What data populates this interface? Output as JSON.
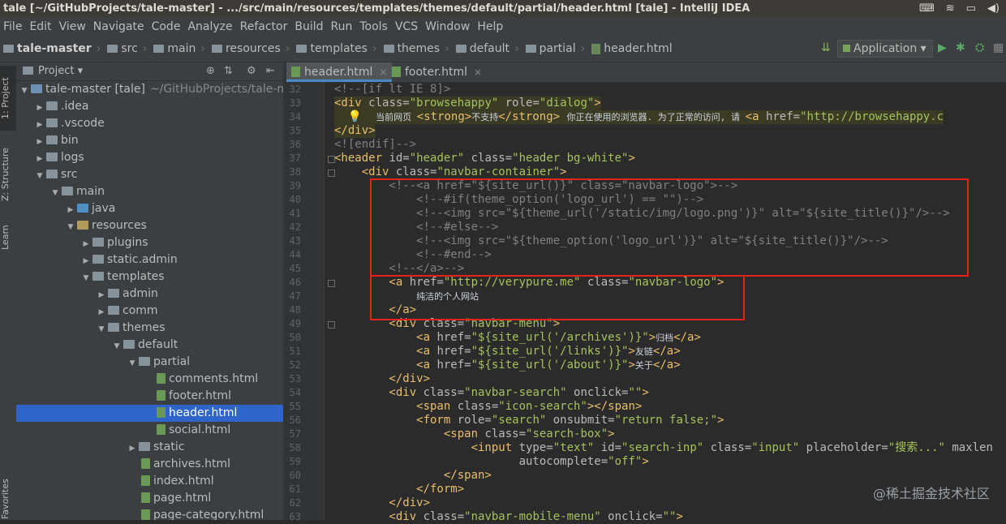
{
  "window": {
    "title": "tale [~/GitHubProjects/tale-master] - .../src/main/resources/templates/themes/default/partial/header.html [tale] - IntelliJ IDEA"
  },
  "tray": {
    "input_label": "⌨",
    "wifi": "≋",
    "battery": "▭",
    "volume": "◀)"
  },
  "menu": [
    "File",
    "Edit",
    "View",
    "Navigate",
    "Code",
    "Analyze",
    "Refactor",
    "Build",
    "Run",
    "Tools",
    "VCS",
    "Window",
    "Help"
  ],
  "breadcrumbs": [
    "tale-master",
    "src",
    "main",
    "resources",
    "templates",
    "themes",
    "default",
    "partial",
    "header.html"
  ],
  "toolbar": {
    "run_config": "Application ▾"
  },
  "left_strip": {
    "project": "1: Project",
    "structure": "Z: Structure",
    "learn": "Learn",
    "favorites": "Favorites"
  },
  "project_panel": {
    "title": "Project ▾"
  },
  "tree": [
    {
      "label": "tale-master [tale]",
      "hint": "~/GitHubProjects/tale-ma",
      "depth": 0,
      "arrow": "▼",
      "icon": "module"
    },
    {
      "label": ".idea",
      "depth": 1,
      "arrow": "▶",
      "icon": "folder"
    },
    {
      "label": ".vscode",
      "depth": 1,
      "arrow": "▶",
      "icon": "folder"
    },
    {
      "label": "bin",
      "depth": 1,
      "arrow": "▶",
      "icon": "folder"
    },
    {
      "label": "logs",
      "depth": 1,
      "arrow": "▶",
      "icon": "folder"
    },
    {
      "label": "src",
      "depth": 1,
      "arrow": "▼",
      "icon": "folder"
    },
    {
      "label": "main",
      "depth": 2,
      "arrow": "▼",
      "icon": "folder"
    },
    {
      "label": "java",
      "depth": 3,
      "arrow": "▶",
      "icon": "src"
    },
    {
      "label": "resources",
      "depth": 3,
      "arrow": "▼",
      "icon": "res"
    },
    {
      "label": "plugins",
      "depth": 4,
      "arrow": "▶",
      "icon": "folder"
    },
    {
      "label": "static.admin",
      "depth": 4,
      "arrow": "▶",
      "icon": "folder"
    },
    {
      "label": "templates",
      "depth": 4,
      "arrow": "▼",
      "icon": "folder"
    },
    {
      "label": "admin",
      "depth": 5,
      "arrow": "▶",
      "icon": "folder"
    },
    {
      "label": "comm",
      "depth": 5,
      "arrow": "▶",
      "icon": "folder"
    },
    {
      "label": "themes",
      "depth": 5,
      "arrow": "▼",
      "icon": "folder"
    },
    {
      "label": "default",
      "depth": 6,
      "arrow": "▼",
      "icon": "folder"
    },
    {
      "label": "partial",
      "depth": 7,
      "arrow": "▼",
      "icon": "folder"
    },
    {
      "label": "comments.html",
      "depth": 8,
      "arrow": "",
      "icon": "html"
    },
    {
      "label": "footer.html",
      "depth": 8,
      "arrow": "",
      "icon": "html"
    },
    {
      "label": "header.html",
      "depth": 8,
      "arrow": "",
      "icon": "html",
      "selected": true
    },
    {
      "label": "social.html",
      "depth": 8,
      "arrow": "",
      "icon": "html"
    },
    {
      "label": "static",
      "depth": 7,
      "arrow": "▶",
      "icon": "folder"
    },
    {
      "label": "archives.html",
      "depth": 7,
      "arrow": "",
      "icon": "html"
    },
    {
      "label": "index.html",
      "depth": 7,
      "arrow": "",
      "icon": "html"
    },
    {
      "label": "page.html",
      "depth": 7,
      "arrow": "",
      "icon": "html"
    },
    {
      "label": "page-category.html",
      "depth": 7,
      "arrow": "",
      "icon": "html"
    }
  ],
  "tabs": [
    {
      "label": "header.html",
      "active": true
    },
    {
      "label": "footer.html",
      "active": false
    }
  ],
  "code": {
    "first_line": 32,
    "lines": [
      [
        [
          "c",
          "<!--[if lt IE 8]>"
        ]
      ],
      [
        [
          "t",
          "<div "
        ],
        [
          "a",
          "class="
        ],
        [
          "v",
          "\"browsehappy\" "
        ],
        [
          "a",
          "role="
        ],
        [
          "v",
          "\"dialog\""
        ],
        [
          "t",
          ">"
        ]
      ],
      [
        [
          "a",
          "  💡  "
        ],
        [
          "z",
          "当前网页 "
        ],
        [
          "t",
          "<strong>"
        ],
        [
          "z",
          "不支持"
        ],
        [
          "t",
          "</strong> "
        ],
        [
          "z",
          "你正在使用的浏览器. 为了正常的访问, 请 "
        ],
        [
          "t",
          "<a "
        ],
        [
          "a",
          "href="
        ],
        [
          "v",
          "\"http://browsehappy.c"
        ]
      ],
      [
        [
          "t",
          "</div>"
        ]
      ],
      [
        [
          "c",
          "<![endif]-->"
        ]
      ],
      [
        [
          "t",
          "<header "
        ],
        [
          "a",
          "id="
        ],
        [
          "v",
          "\"header\" "
        ],
        [
          "a",
          "class="
        ],
        [
          "v",
          "\"header bg-white\""
        ],
        [
          "t",
          ">"
        ]
      ],
      [
        [
          "t",
          "    <div "
        ],
        [
          "a",
          "class="
        ],
        [
          "v",
          "\"navbar-container\""
        ],
        [
          "t",
          ">"
        ]
      ],
      [
        [
          "c",
          "        <!--<a href=\"${site_url()}\" class=\"navbar-logo\">-->"
        ]
      ],
      [
        [
          "c",
          "            <!--#if(theme_option('logo_url') == \"\")-->"
        ]
      ],
      [
        [
          "c",
          "            <!--<img src=\"${theme_url('/static/img/logo.png')}\" alt=\"${site_title()}\"/>-->"
        ]
      ],
      [
        [
          "c",
          "            <!--#else-->"
        ]
      ],
      [
        [
          "c",
          "            <!--<img src=\"${theme_option('logo_url')}\" alt=\"${site_title()}\"/>-->"
        ]
      ],
      [
        [
          "c",
          "            <!--#end-->"
        ]
      ],
      [
        [
          "c",
          "        <!--</a>-->"
        ]
      ],
      [
        [
          "t",
          "        <a "
        ],
        [
          "a",
          "href="
        ],
        [
          "v",
          "\"http://verypure.me\" "
        ],
        [
          "a",
          "class="
        ],
        [
          "v",
          "\"navbar-logo\""
        ],
        [
          "t",
          ">"
        ]
      ],
      [
        [
          "a",
          "            "
        ],
        [
          "z",
          "纯洁的个人网站"
        ]
      ],
      [
        [
          "t",
          "        </a>"
        ]
      ],
      [
        [
          "t",
          "        <div "
        ],
        [
          "a",
          "class="
        ],
        [
          "v",
          "\"navbar-menu\""
        ],
        [
          "t",
          ">"
        ]
      ],
      [
        [
          "t",
          "            <a "
        ],
        [
          "a",
          "href="
        ],
        [
          "v",
          "\"${site_url('/archives')}\""
        ],
        [
          "t",
          ">"
        ],
        [
          "z",
          "归档"
        ],
        [
          "t",
          "</a>"
        ]
      ],
      [
        [
          "t",
          "            <a "
        ],
        [
          "a",
          "href="
        ],
        [
          "v",
          "\"${site_url('/links')}\""
        ],
        [
          "t",
          ">"
        ],
        [
          "z",
          "友链"
        ],
        [
          "t",
          "</a>"
        ]
      ],
      [
        [
          "t",
          "            <a "
        ],
        [
          "a",
          "href="
        ],
        [
          "v",
          "\"${site_url('/about')}\""
        ],
        [
          "t",
          ">"
        ],
        [
          "z",
          "关于"
        ],
        [
          "t",
          "</a>"
        ]
      ],
      [
        [
          "t",
          "        </div>"
        ]
      ],
      [
        [
          "t",
          "        <div "
        ],
        [
          "a",
          "class="
        ],
        [
          "v",
          "\"navbar-search\" "
        ],
        [
          "a",
          "onclick="
        ],
        [
          "v",
          "\"\""
        ],
        [
          "t",
          ">"
        ]
      ],
      [
        [
          "t",
          "            <span "
        ],
        [
          "a",
          "class="
        ],
        [
          "v",
          "\"icon-search\""
        ],
        [
          "t",
          "></span>"
        ]
      ],
      [
        [
          "t",
          "            <form "
        ],
        [
          "a",
          "role="
        ],
        [
          "v",
          "\"search\" "
        ],
        [
          "a",
          "onsubmit="
        ],
        [
          "v",
          "\"return false;\""
        ],
        [
          "t",
          ">"
        ]
      ],
      [
        [
          "t",
          "                <span "
        ],
        [
          "a",
          "class="
        ],
        [
          "v",
          "\"search-box\""
        ],
        [
          "t",
          ">"
        ]
      ],
      [
        [
          "t",
          "                    <input "
        ],
        [
          "a",
          "type="
        ],
        [
          "v",
          "\"text\" "
        ],
        [
          "a",
          "id="
        ],
        [
          "v",
          "\"search-inp\" "
        ],
        [
          "a",
          "class="
        ],
        [
          "v",
          "\"input\" "
        ],
        [
          "a",
          "placeholder="
        ],
        [
          "v",
          "\"搜索...\" "
        ],
        [
          "a",
          "maxlen"
        ]
      ],
      [
        [
          "a",
          "                           autocomplete="
        ],
        [
          "v",
          "\"off\""
        ],
        [
          "t",
          ">"
        ]
      ],
      [
        [
          "t",
          "                </span>"
        ]
      ],
      [
        [
          "t",
          "            </form>"
        ]
      ],
      [
        [
          "t",
          "        </div>"
        ]
      ],
      [
        [
          "t",
          "        <div "
        ],
        [
          "a",
          "class="
        ],
        [
          "v",
          "\"navbar-mobile-menu\" "
        ],
        [
          "a",
          "onclick="
        ],
        [
          "v",
          "\"\""
        ],
        [
          "t",
          ">"
        ]
      ]
    ]
  },
  "watermark": "@稀土掘金技术社区"
}
